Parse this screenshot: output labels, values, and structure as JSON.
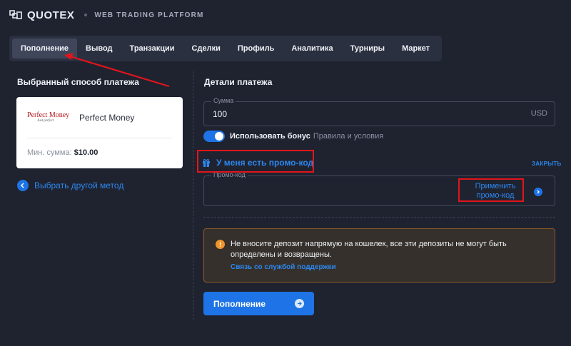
{
  "header": {
    "logo_text": "QUOTEX",
    "subtitle": "WEB TRADING PLATFORM",
    "logo_icon": "quotex-logo-icon"
  },
  "tabs": [
    {
      "label": "Пополнение",
      "active": true
    },
    {
      "label": "Вывод",
      "active": false
    },
    {
      "label": "Транзакции",
      "active": false
    },
    {
      "label": "Сделки",
      "active": false
    },
    {
      "label": "Профиль",
      "active": false
    },
    {
      "label": "Аналитика",
      "active": false
    },
    {
      "label": "Турниры",
      "active": false
    },
    {
      "label": "Маркет",
      "active": false
    }
  ],
  "left": {
    "title": "Выбранный способ платежа",
    "method": {
      "logo_text": "Perfect Money",
      "logo_sub": "Just perfect",
      "name": "Perfect Money",
      "min_label": "Мин. сумма:",
      "min_value": "$10.00"
    },
    "choose_other": "Выбрать другой метод"
  },
  "right": {
    "title": "Детали платежа",
    "amount": {
      "label": "Сумма",
      "value": "100",
      "currency": "USD"
    },
    "bonus": {
      "enabled": true,
      "label": "Использовать бонус",
      "rules": "Правила и условия"
    },
    "promo_toggle": "У меня есть промо-код",
    "close": "ЗАКРЫТЬ",
    "promo": {
      "label": "Промо-код",
      "value": "",
      "apply": "Применить промо-код"
    },
    "warning": {
      "text": "Не вносите депозит напрямую на кошелек, все эти депозиты не могут быть определены и возвращены.",
      "link": "Связь со службой поддержки"
    },
    "deposit_button": "Пополнение"
  },
  "colors": {
    "background": "#1f2330",
    "accent": "#1e74e6",
    "link": "#2d87ee",
    "warning": "#f0952d",
    "annotation": "#e3141b"
  }
}
